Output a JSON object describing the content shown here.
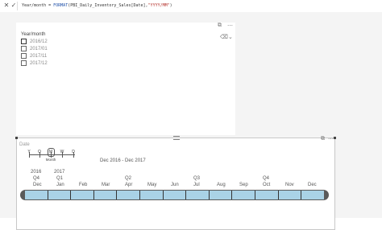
{
  "formula_bar": {
    "prefix": "Year/month = ",
    "function": "FORMAT",
    "argument": "(PBI_Daily_Inventory_Sales[Date],",
    "format_string": "\"YYYY/MM\"",
    "suffix": ")"
  },
  "slicer": {
    "title": "Year/month",
    "items": [
      "2016/12",
      "2017/01",
      "2017/11",
      "2017/12"
    ]
  },
  "timeline": {
    "title": "Date",
    "granularity": [
      "Y",
      "Q",
      "M",
      "W",
      "D"
    ],
    "current_granularity": "Month",
    "range_text": "Dec 2016 - Dec 2017",
    "years": [
      "2016",
      "2017"
    ],
    "quarters": [
      "Q4",
      "Q1",
      "Q2",
      "Q3",
      "Q4"
    ],
    "months": [
      "Dec",
      "Jan",
      "Feb",
      "Mar",
      "Apr",
      "May",
      "Jun",
      "Jul",
      "Aug",
      "Sep",
      "Oct",
      "Nov",
      "Dec"
    ]
  },
  "icons": {
    "cancel": "close-icon",
    "commit": "check-icon",
    "eraser": "eraser-icon",
    "chevron": "chevron-down-icon",
    "grip": "grip-icon",
    "filter": "filter-icon",
    "focus": "focus-mode-icon",
    "more": "more-options-icon"
  }
}
